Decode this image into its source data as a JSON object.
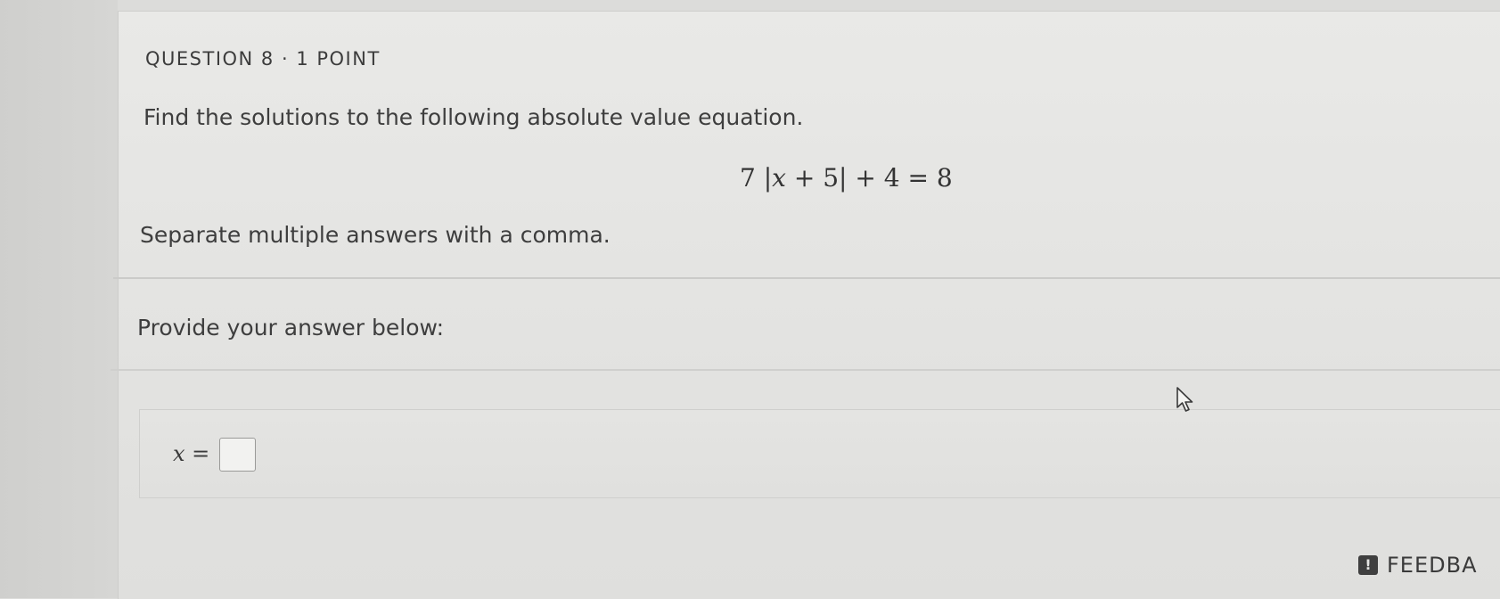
{
  "question": {
    "label": "QUESTION 8 · 1 POINT",
    "prompt": "Find the solutions to the following absolute value equation.",
    "equation": {
      "coefficient": "7",
      "bar_open": "|",
      "variable": "x",
      "inner_rest": " + 5",
      "bar_close": "|",
      "rest": " + 4 = 8"
    },
    "instruction": "Separate multiple answers with a comma."
  },
  "answer": {
    "heading": "Provide your answer below:",
    "variable": "x",
    "equals": " =",
    "input_value": ""
  },
  "feedback": {
    "icon": "!",
    "label": "FEEDBA"
  }
}
